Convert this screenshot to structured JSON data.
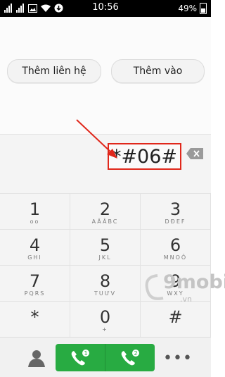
{
  "status_bar": {
    "time": "10:56",
    "battery": "49%",
    "battery_level": 0.49
  },
  "actions": {
    "add_contact": "Thêm liên hệ",
    "add_to": "Thêm vào"
  },
  "dialer": {
    "input": "*#06#"
  },
  "keypad": [
    {
      "digit": "1",
      "letters": "oo"
    },
    {
      "digit": "2",
      "letters": "AÄÂBC"
    },
    {
      "digit": "3",
      "letters": "DĐEF"
    },
    {
      "digit": "4",
      "letters": "GHI"
    },
    {
      "digit": "5",
      "letters": "JKL"
    },
    {
      "digit": "6",
      "letters": "MNOÔ"
    },
    {
      "digit": "7",
      "letters": "PQRS"
    },
    {
      "digit": "8",
      "letters": "TUƯV"
    },
    {
      "digit": "9",
      "letters": "WXY"
    },
    {
      "digit": "*",
      "letters": ""
    },
    {
      "digit": "0",
      "letters": "+"
    },
    {
      "digit": "#",
      "letters": ""
    }
  ],
  "bottom_bar": {
    "sim1": "1",
    "sim2": "2",
    "more": "•••"
  },
  "watermark": {
    "brand": "9mobi",
    "suffix": ".vn"
  },
  "colors": {
    "call_green": "#28ab42",
    "highlight_red": "#e0271b"
  }
}
